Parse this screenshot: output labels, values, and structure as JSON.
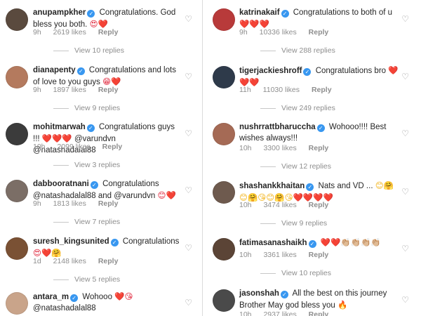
{
  "left": [
    {
      "user": "anupampkher",
      "text": "Congratulations. God bless you both.",
      "emoji": "😍❤️",
      "time": "9h",
      "likes": "2619 likes",
      "reply": "Reply",
      "view": "View 10 replies",
      "avatar_color": "#5a4a3e"
    },
    {
      "user": "dianapenty",
      "text": "Congratulations and lots of love to you guys",
      "emoji": "😁❤️",
      "time": "9h",
      "likes": "1897 likes",
      "reply": "Reply",
      "view": "View 9 replies",
      "avatar_color": "#b47a5e"
    },
    {
      "user": "mohitmarwah",
      "text": "Congratulations guys !!!",
      "emoji": "❤️❤️❤️",
      "text2": "@varundvn @natashadalal88",
      "time": "10h",
      "likes": "2099 likes",
      "reply": "Reply",
      "view": "View 3 replies",
      "avatar_color": "#3b3b3b"
    },
    {
      "user": "dabbooratnani",
      "text": "Congratulations @natashadalal88 and @varundvn",
      "emoji": "😊❤️",
      "time": "9h",
      "likes": "1813 likes",
      "reply": "Reply",
      "view": "View 7 replies",
      "avatar_color": "#7b6e66"
    },
    {
      "user": "suresh_kingsunited",
      "text": "Congratulations",
      "emoji": "😍❤️🤗",
      "time": "1d",
      "likes": "2148 likes",
      "reply": "Reply",
      "view": "View 5 replies",
      "avatar_color": "#7a5134"
    },
    {
      "user": "antara_m",
      "text": "Wohooo",
      "emoji": "❤️😘",
      "text2": "@natashadalal88",
      "time": "",
      "likes": "",
      "reply": "",
      "view": "",
      "avatar_color": "#c9a48a"
    }
  ],
  "right": [
    {
      "user": "katrinakaif",
      "text": "Congratulations to both of u",
      "emoji": "❤️❤️❤️",
      "time": "9h",
      "likes": "10336 likes",
      "reply": "Reply",
      "view": "View 288 replies",
      "avatar_color": "#b83a3a"
    },
    {
      "user": "tigerjackieshroff",
      "text": "Congratulations bro",
      "emoji": "❤️❤️❤️",
      "time": "11h",
      "likes": "11030 likes",
      "reply": "Reply",
      "view": "View 249 replies",
      "avatar_color": "#2e3a4a"
    },
    {
      "user": "nushrrattbharuccha",
      "text": "Wohooo!!!! Best wishes always!!!",
      "emoji": "",
      "time": "10h",
      "likes": "3300 likes",
      "reply": "Reply",
      "view": "View 12 replies",
      "avatar_color": "#a56a55"
    },
    {
      "user": "shashankkhaitan",
      "text": "Nats and VD ...",
      "emoji": "😊🤗😊🤗😘😊🤗😘❤️❤️❤️❤️",
      "time": "10h",
      "likes": "3474 likes",
      "reply": "Reply",
      "view": "View 9 replies",
      "avatar_color": "#6e5a4e"
    },
    {
      "user": "fatimasanashaikh",
      "text": "",
      "emoji": "❤️❤️👏🏼👏🏼👏🏼👏🏼",
      "time": "10h",
      "likes": "3361 likes",
      "reply": "Reply",
      "view": "View 10 replies",
      "avatar_color": "#5b4436"
    },
    {
      "user": "jasonshah",
      "text": "All the best on this journey Brother May god bless you",
      "emoji": "🔥",
      "time": "10h",
      "likes": "2937 likes",
      "reply": "Reply",
      "view": "",
      "avatar_color": "#4a4a4a"
    }
  ],
  "icons": {
    "heart": "♡",
    "verified": "✓"
  }
}
